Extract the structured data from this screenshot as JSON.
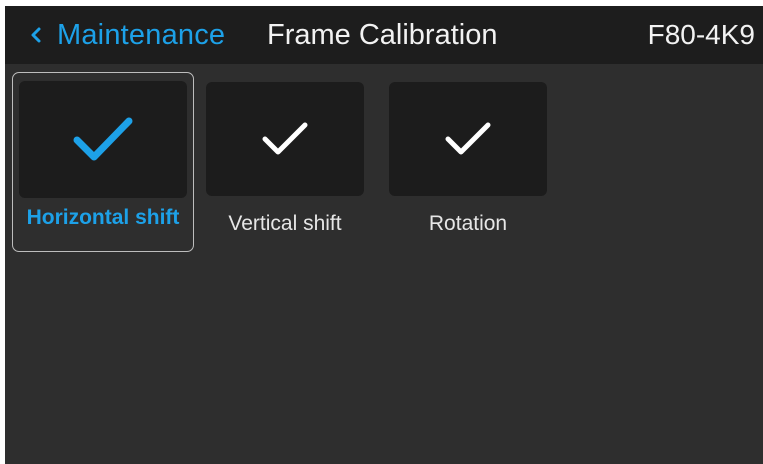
{
  "header": {
    "back_label": "Maintenance",
    "title": "Frame Calibration",
    "device": "F80-4K9"
  },
  "tiles": [
    {
      "label": "Horizontal shift",
      "icon": "check-icon",
      "selected": true
    },
    {
      "label": "Vertical shift",
      "icon": "check-icon",
      "selected": false
    },
    {
      "label": "Rotation",
      "icon": "check-icon",
      "selected": false
    }
  ],
  "colors": {
    "accent": "#1da1e8",
    "header_bg": "#1d1d1d",
    "screen_bg": "#2e2e2e",
    "tile_bg": "#1c1c1c"
  }
}
